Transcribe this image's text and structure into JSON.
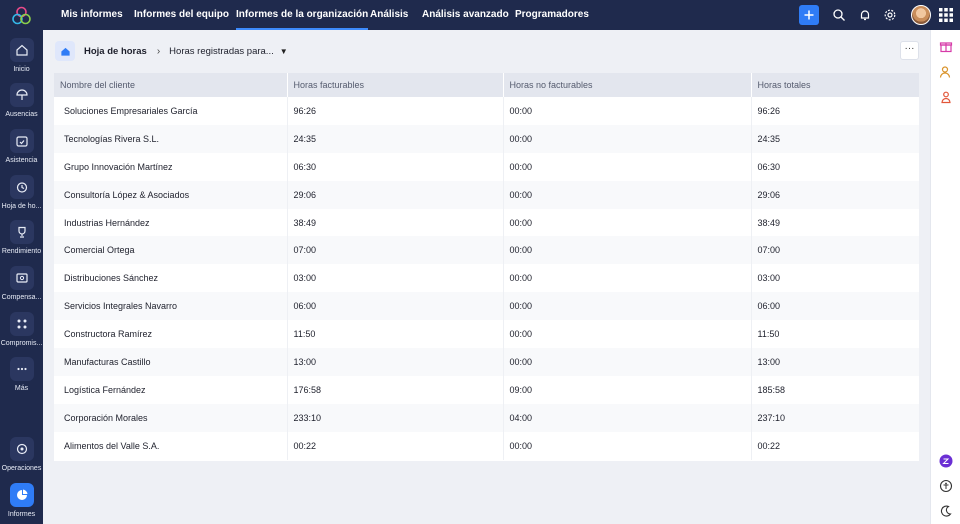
{
  "sidebar": {
    "items": [
      {
        "label": "Inicio",
        "icon": "home-icon"
      },
      {
        "label": "Ausencias",
        "icon": "umbrella-icon"
      },
      {
        "label": "Asistencia",
        "icon": "calendar-check-icon"
      },
      {
        "label": "Hoja de ho...",
        "icon": "timesheet-icon"
      },
      {
        "label": "Rendimiento",
        "icon": "trophy-icon"
      },
      {
        "label": "Compensa...",
        "icon": "compensation-icon"
      },
      {
        "label": "Compromis...",
        "icon": "engagement-icon"
      },
      {
        "label": "Más",
        "icon": "more-dots-icon"
      },
      {
        "label": "Operaciones",
        "icon": "operations-icon"
      },
      {
        "label": "Informes",
        "icon": "pie-chart-icon",
        "active": true
      }
    ]
  },
  "topnav": {
    "tabs": [
      {
        "label": "Mis informes"
      },
      {
        "label": "Informes del equipo"
      },
      {
        "label": "Informes de la organización",
        "active": true
      },
      {
        "label": "Análisis"
      },
      {
        "label": "Análisis avanzado"
      },
      {
        "label": "Programadores"
      }
    ],
    "accent": "#2f7cf6"
  },
  "breadcrumb": {
    "root": "Hoja de horas",
    "current": "Horas registradas para..."
  },
  "more_label": "···",
  "table": {
    "columns": [
      "Nombre del cliente",
      "Horas facturables",
      "Horas no facturables",
      "Horas totales"
    ],
    "rows": [
      [
        "Soluciones Empresariales García",
        "96:26",
        "00:00",
        "96:26"
      ],
      [
        "Tecnologías Rivera S.L.",
        "24:35",
        "00:00",
        "24:35"
      ],
      [
        "Grupo Innovación Martínez",
        "06:30",
        "00:00",
        "06:30"
      ],
      [
        "Consultoría López & Asociados",
        "29:06",
        "00:00",
        "29:06"
      ],
      [
        "Industrias Hernández",
        "38:49",
        "00:00",
        "38:49"
      ],
      [
        "Comercial Ortega",
        "07:00",
        "00:00",
        "07:00"
      ],
      [
        "Distribuciones Sánchez",
        "03:00",
        "00:00",
        "03:00"
      ],
      [
        "Servicios Integrales Navarro",
        "06:00",
        "00:00",
        "06:00"
      ],
      [
        "Constructora Ramírez",
        "11:50",
        "00:00",
        "11:50"
      ],
      [
        "Manufacturas Castillo",
        "13:00",
        "00:00",
        "13:00"
      ],
      [
        "Logística Fernández",
        "176:58",
        "09:00",
        "185:58"
      ],
      [
        "Corporación Morales",
        "233:10",
        "04:00",
        "237:10"
      ],
      [
        " Alimentos del Valle S.A.",
        "00:22",
        "00:00",
        "00:22"
      ]
    ]
  }
}
